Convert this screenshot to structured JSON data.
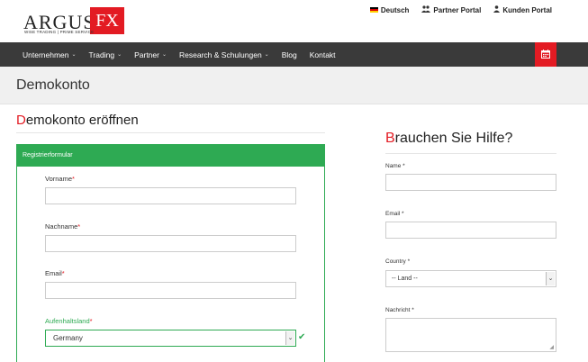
{
  "brand": {
    "name": "ARGUS",
    "fx": "FX",
    "tagline": "WISE TRADING | PRIME SERVICE"
  },
  "top_links": [
    {
      "label": "Deutsch",
      "icon": "german-flag-icon"
    },
    {
      "label": "Partner Portal",
      "icon": "users-icon"
    },
    {
      "label": "Kunden Portal",
      "icon": "user-icon"
    }
  ],
  "nav": [
    {
      "label": "Unternehmen",
      "chevron": "⌄"
    },
    {
      "label": "Trading",
      "chevron": "⌄"
    },
    {
      "label": "Partner",
      "chevron": "⌄"
    },
    {
      "label": "Research & Schulungen",
      "chevron": "⌄"
    },
    {
      "label": "Blog",
      "chevron": ""
    },
    {
      "label": "Kontakt",
      "chevron": ""
    }
  ],
  "page_title": "Demokonto",
  "section": {
    "first_letter": "D",
    "rest": "emokonto eröffnen"
  },
  "form": {
    "header": "Registrierformular",
    "required_mark": "*",
    "fields": {
      "vorname": "Vorname",
      "nachname": "Nachname",
      "email": "Email",
      "country": "Aufenhaltsland"
    },
    "country_value": "Germany"
  },
  "help": {
    "first_letter": "B",
    "rest": "rauchen Sie Hilfe?",
    "name_label": "Name *",
    "email_label": "Email *",
    "country_label": "Country *",
    "country_placeholder": "-- Land --",
    "message_label": "Nachricht *"
  },
  "colors": {
    "accent_red": "#e31b23",
    "success_green": "#2eaa53",
    "nav_bg": "#3a3a3a"
  }
}
